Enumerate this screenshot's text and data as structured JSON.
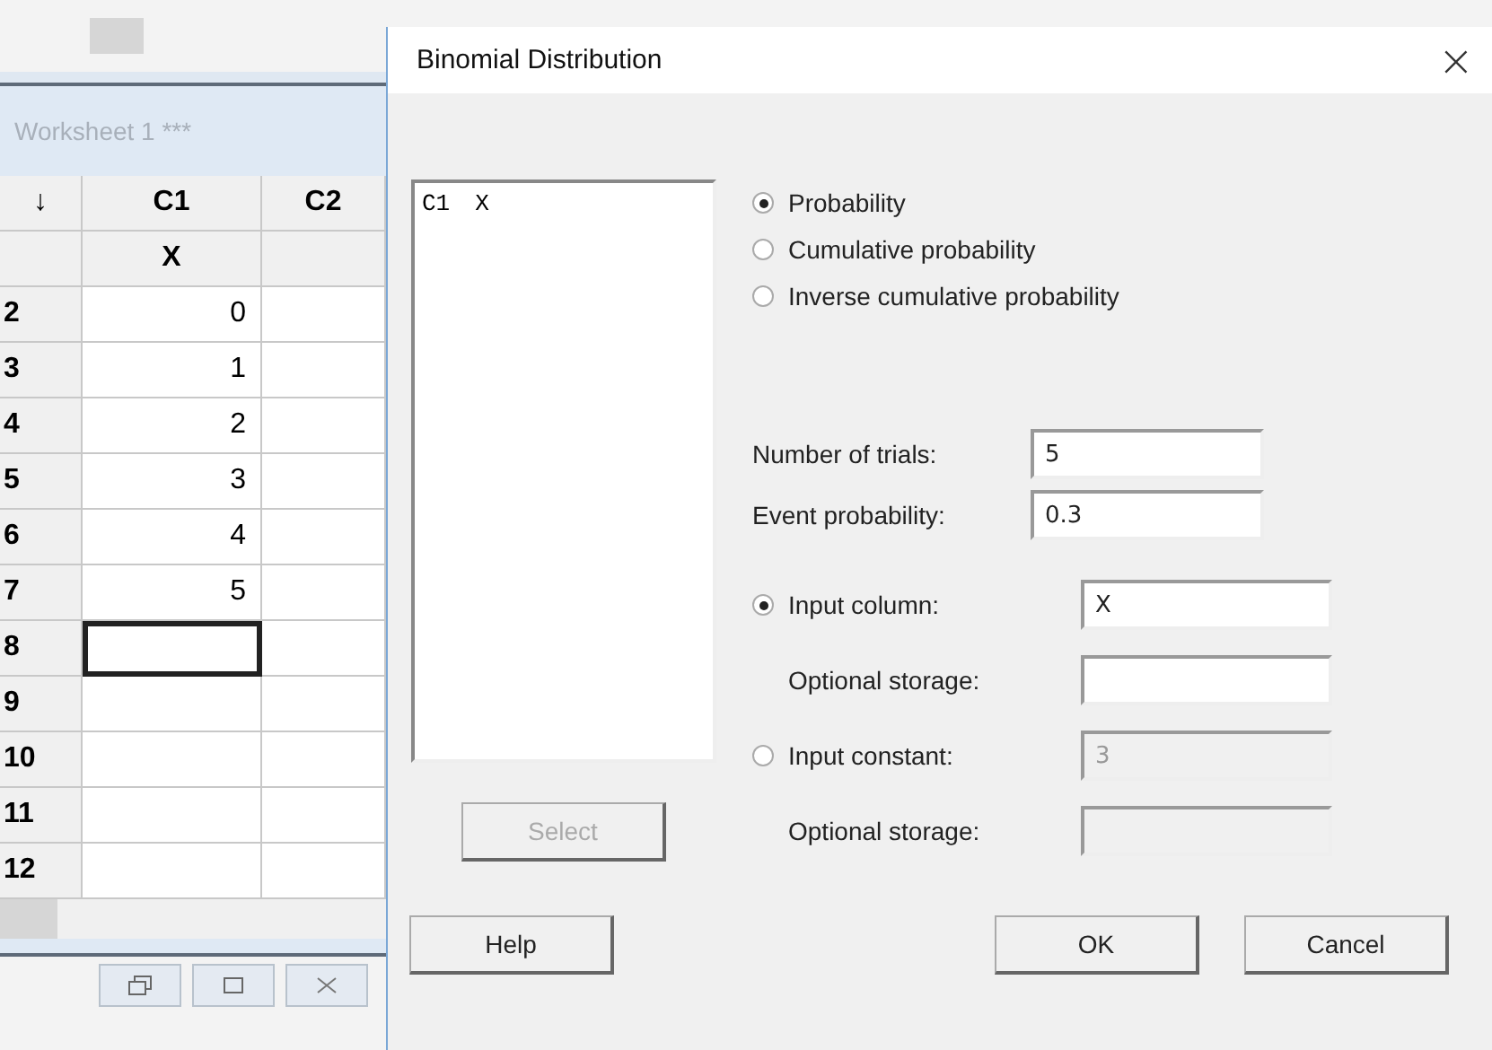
{
  "worksheet": {
    "title": "Worksheet 1 ***",
    "header": {
      "row_label": "↓",
      "columns": [
        "C1",
        "C2"
      ]
    },
    "names": [
      "X"
    ],
    "rows": [
      {
        "label": "2",
        "c1": "0",
        "selected": false
      },
      {
        "label": "3",
        "c1": "1",
        "selected": false
      },
      {
        "label": "4",
        "c1": "2",
        "selected": false
      },
      {
        "label": "5",
        "c1": "3",
        "selected": false
      },
      {
        "label": "6",
        "c1": "4",
        "selected": false
      },
      {
        "label": "7",
        "c1": "5",
        "selected": false
      },
      {
        "label": "8",
        "c1": "",
        "selected": true
      },
      {
        "label": "9",
        "c1": "",
        "selected": false
      },
      {
        "label": "10",
        "c1": "",
        "selected": false
      },
      {
        "label": "11",
        "c1": "",
        "selected": false
      },
      {
        "label": "12",
        "c1": "",
        "selected": false
      }
    ]
  },
  "dialog": {
    "title": "Binomial Distribution",
    "close": "×",
    "columns_list": [
      {
        "column": "C1",
        "name": "X"
      }
    ],
    "select_button": {
      "label": "Select",
      "disabled": true
    },
    "modes": [
      {
        "label": "Probability",
        "selected": true
      },
      {
        "label": "Cumulative probability",
        "selected": false
      },
      {
        "label": "Inverse cumulative probability",
        "selected": false
      }
    ],
    "params": [
      {
        "label": "Number of trials:",
        "value": "5"
      },
      {
        "label": "Event probability:",
        "value": "0.3"
      }
    ],
    "inputs": [
      {
        "label": "Input column:",
        "value": "X",
        "selected": true,
        "storage_label": "Optional storage:"
      },
      {
        "label": "Input constant:",
        "value": "3",
        "selected": false,
        "storage_label": "Optional storage:"
      }
    ],
    "buttons": [
      {
        "label": "Help"
      },
      {
        "label": "OK"
      },
      {
        "label": "Cancel"
      }
    ]
  }
}
